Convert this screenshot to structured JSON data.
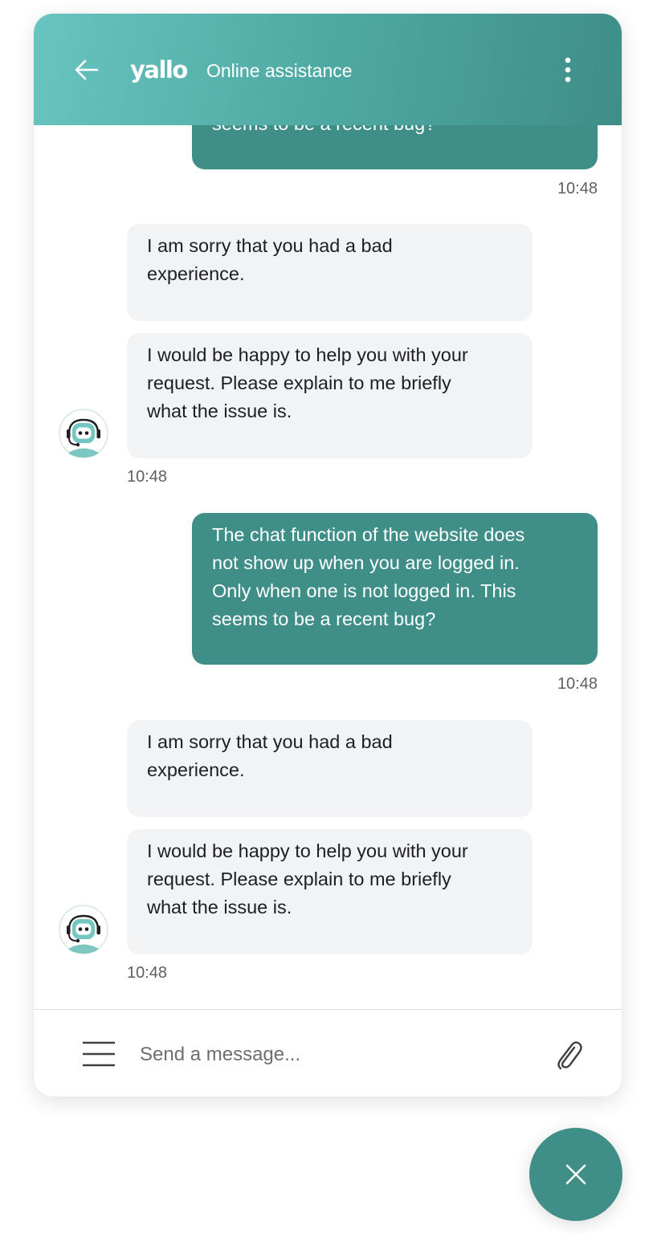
{
  "header": {
    "logo_text": "yallo",
    "title": "Online assistance"
  },
  "messages": [
    {
      "sender": "user",
      "text": "The chat function of the website does not show up when you are logged in. Only when one is not logged in. This seems to be a recent bug?",
      "visible_text": "seems to be a recent bug?",
      "time": "10:48"
    },
    {
      "sender": "bot",
      "text": "I am sorry that you had a bad\nexperience."
    },
    {
      "sender": "bot",
      "text": "I would be happy to help you with your\nrequest. Please explain to me briefly\nwhat the issue is.",
      "time": "10:48"
    },
    {
      "sender": "user",
      "text": "The chat function of the website does\nnot show up when you are logged in.\nOnly when one is not logged in. This\nseems to be a recent bug?",
      "time": "10:48"
    },
    {
      "sender": "bot",
      "text": "I am sorry that you had a bad\nexperience."
    },
    {
      "sender": "bot",
      "text": "I would be happy to help you with your\nrequest. Please explain to me briefly\nwhat the issue is.",
      "time": "10:48"
    }
  ],
  "composer": {
    "placeholder": "Send a message...",
    "value": ""
  },
  "icons": {
    "back": "arrow-left-icon",
    "menu": "more-vertical-icon",
    "hamburger": "hamburger-menu-icon",
    "attach": "paperclip-icon",
    "avatar": "robot-headset-icon",
    "close": "close-icon"
  },
  "colors": {
    "brand": "#3f8e88",
    "header_start": "#68c4bf",
    "header_end": "#3f8e88",
    "bot_bubble": "#f2f3f5",
    "timestamp": "#5c5f63"
  }
}
